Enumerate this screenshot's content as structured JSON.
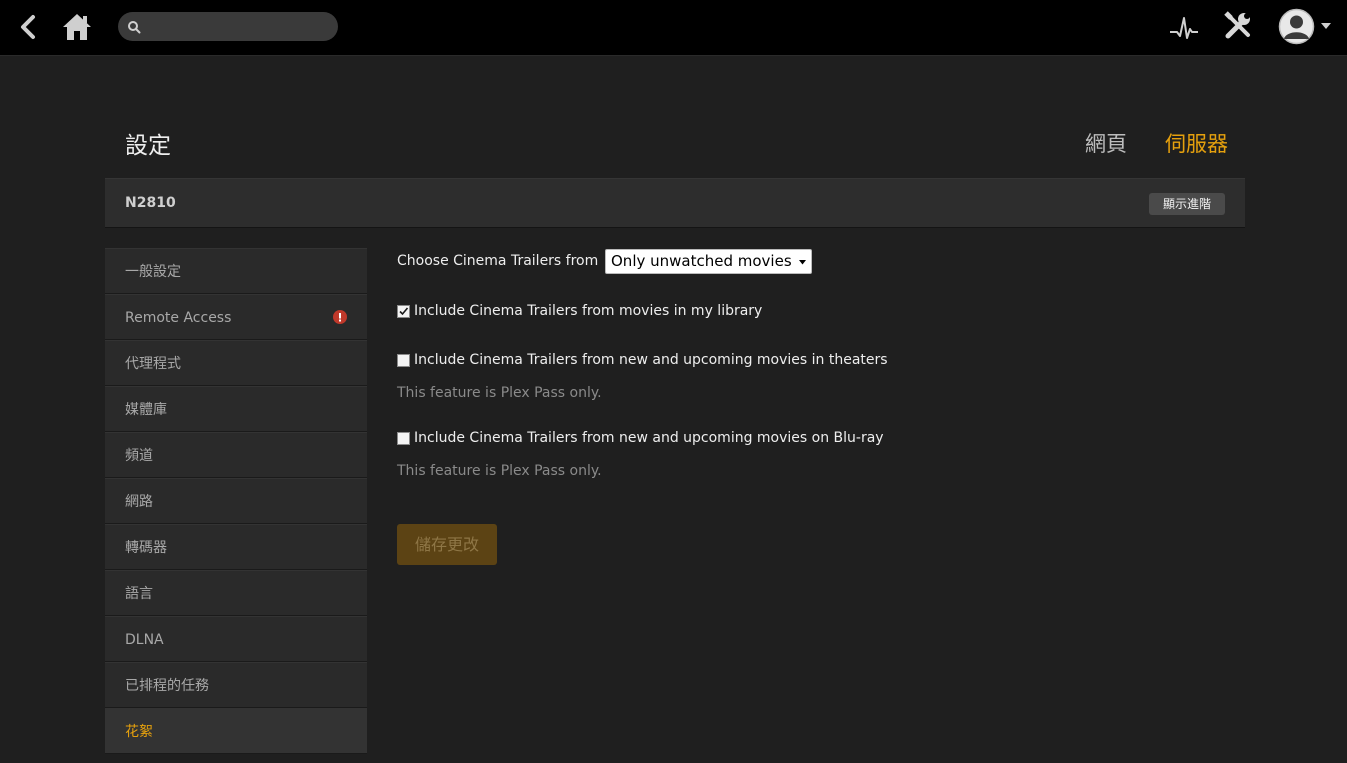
{
  "topbar": {
    "search_placeholder": "",
    "icons": [
      "back-arrow-icon",
      "home-icon",
      "search-icon",
      "activity-icon",
      "tools-icon",
      "user-avatar-icon",
      "caret-down-icon"
    ]
  },
  "header": {
    "title": "設定",
    "tab_web": "網頁",
    "tab_server": "伺服器"
  },
  "server": {
    "name": "N2810",
    "advanced_label": "顯示進階"
  },
  "sidebar": {
    "items": [
      {
        "label": "一般設定"
      },
      {
        "label": "Remote Access"
      },
      {
        "label": "代理程式"
      },
      {
        "label": "媒體庫"
      },
      {
        "label": "頻道"
      },
      {
        "label": "網路"
      },
      {
        "label": "轉碼器"
      },
      {
        "label": "語言"
      },
      {
        "label": "DLNA"
      },
      {
        "label": "已排程的任務"
      },
      {
        "label": "花絮"
      }
    ],
    "active_index": 10
  },
  "main": {
    "choose_label": "Choose Cinema Trailers from",
    "choose_value": "Only unwatched movies",
    "checks": [
      {
        "label": "Include Cinema Trailers from movies in my library",
        "checked": true
      },
      {
        "label": "Include Cinema Trailers from new and upcoming movies in theaters",
        "checked": false
      },
      {
        "label": "Include Cinema Trailers from new and upcoming movies on Blu-ray",
        "checked": false
      }
    ],
    "note_theaters": "This feature is Plex Pass only.",
    "note_bluray": "This feature is Plex Pass only.",
    "save_label": "儲存更改"
  },
  "colors": {
    "accent": "#e5a00d",
    "background": "#1f1f1f",
    "topbar": "#000000",
    "warning": "#c0392b"
  }
}
